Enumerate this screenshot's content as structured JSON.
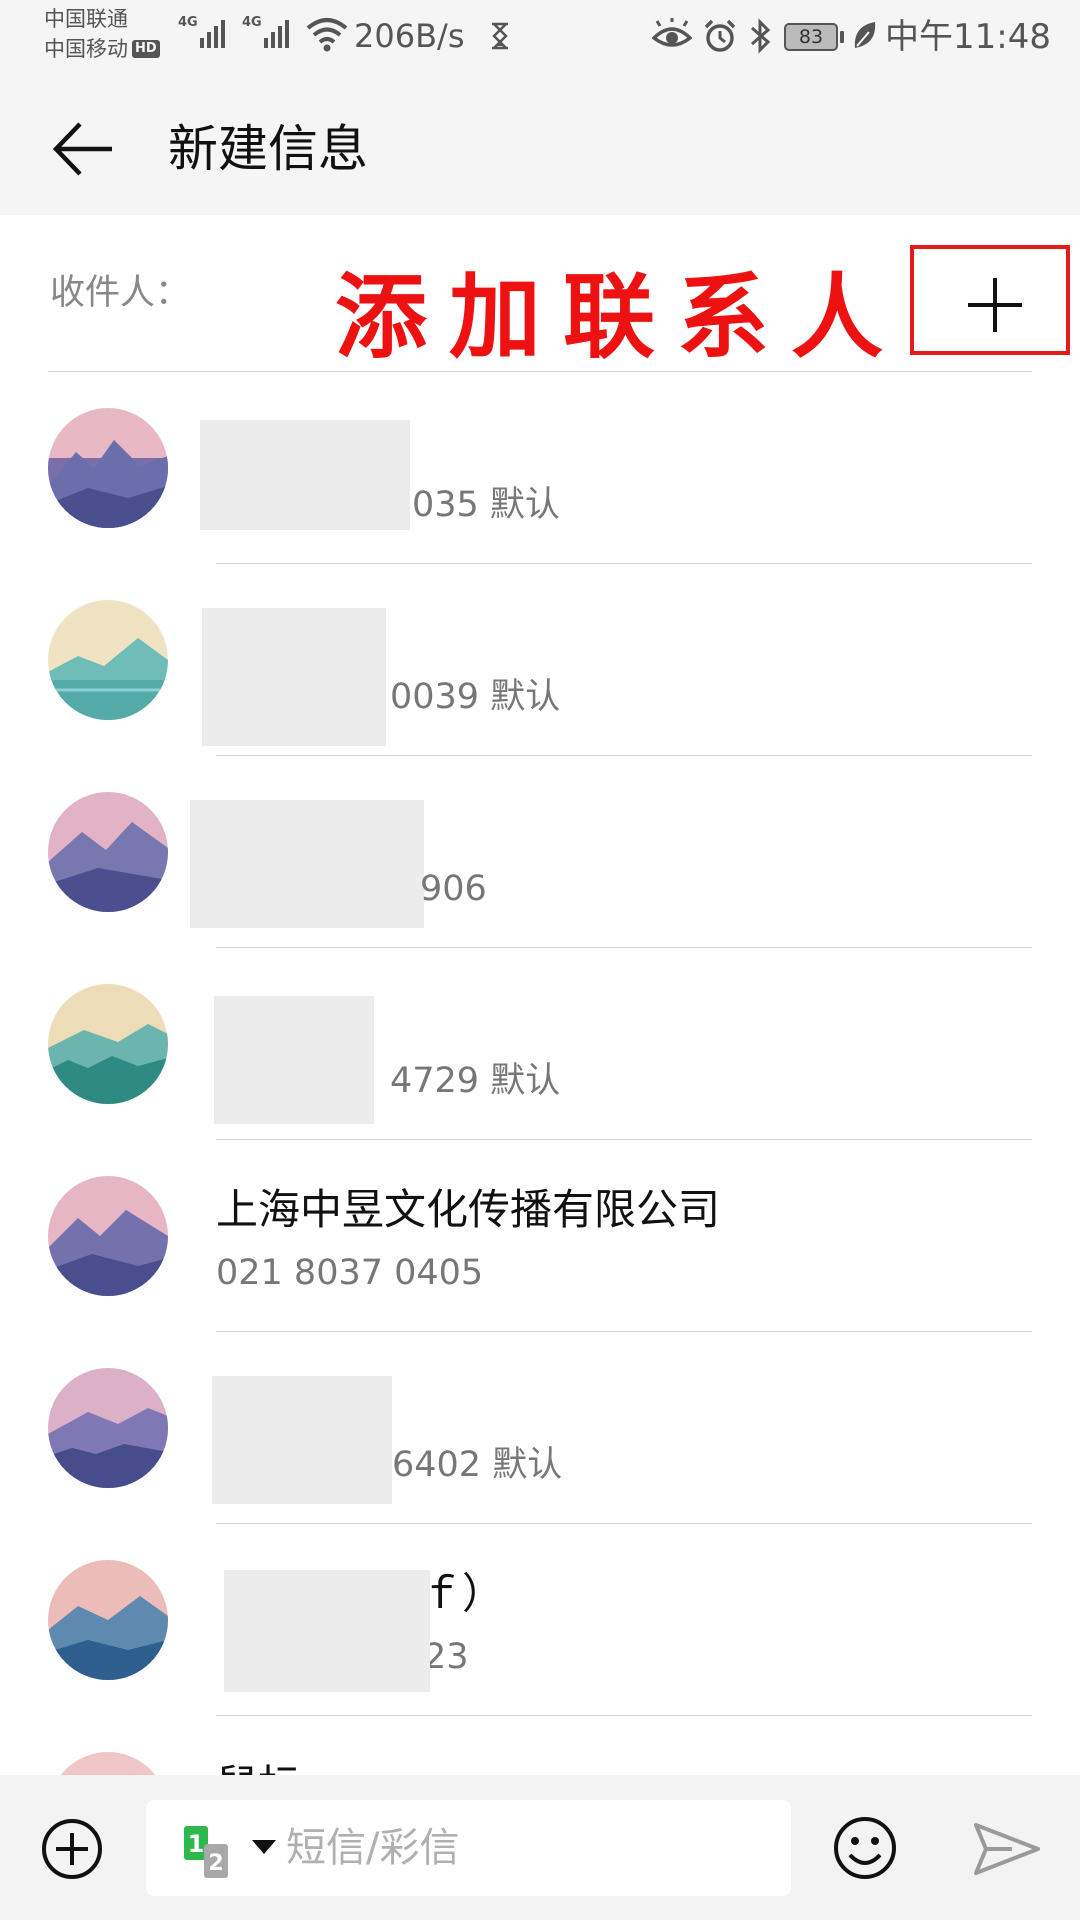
{
  "status_bar": {
    "carrier_1": "中国联通",
    "carrier_2": "中国移动",
    "hd_badge": "HD",
    "network_label_1": "4G",
    "network_label_2": "4G",
    "net_speed": "206B/s",
    "battery": "83",
    "time": "中午11:48"
  },
  "header": {
    "title": "新建信息"
  },
  "recipient": {
    "label": "收件人：",
    "annotation": "添加联系人"
  },
  "contacts": [
    {
      "name": "",
      "detail": "035 默认",
      "avatar": "pink-mountain"
    },
    {
      "name": "",
      "detail": "0039 默认",
      "avatar": "teal-lake"
    },
    {
      "name": "",
      "detail": "906",
      "avatar": "pink-mountain"
    },
    {
      "name": "",
      "detail": "4729 默认",
      "avatar": "teal-forest"
    },
    {
      "name": "上海中昱文化传播有限公司",
      "detail": "021 8037 0405",
      "avatar": "pink-mountain"
    },
    {
      "name": "",
      "detail": "6402 默认",
      "avatar": "pink-forest"
    },
    {
      "name": "‭ｆ）",
      "detail": "23",
      "avatar": "blue-mountain"
    },
    {
      "name": "鼠标",
      "detail": "",
      "avatar": "pink-mountain"
    }
  ],
  "composer": {
    "sim_primary": "1",
    "sim_secondary": "2",
    "placeholder": "短信/彩信"
  },
  "colors": {
    "annotation_red": "#ee1111",
    "sim_green": "#2db84b",
    "background_gray": "#f5f5f5"
  },
  "icons": [
    "back-arrow-icon",
    "add-icon",
    "attach-plus-icon",
    "sim-card-icon",
    "dropdown-icon",
    "emoji-icon",
    "send-icon"
  ]
}
